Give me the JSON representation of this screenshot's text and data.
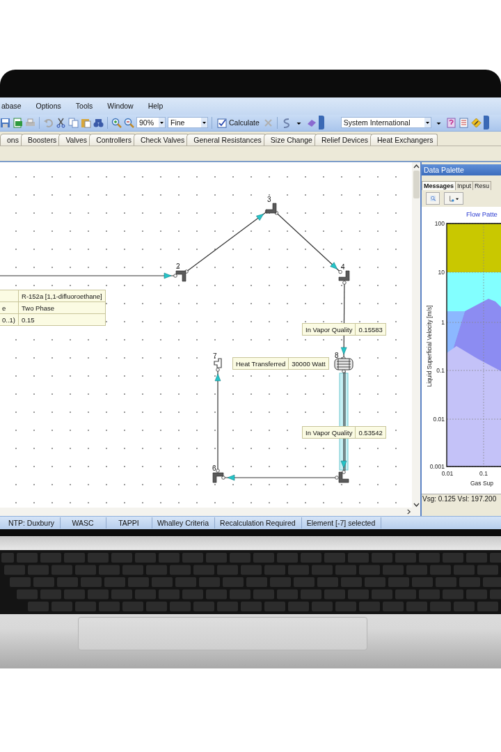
{
  "menu": [
    "abase",
    "Options",
    "Tools",
    "Window",
    "Help"
  ],
  "toolbar": {
    "zoom": "90%",
    "grid": "Fine",
    "calculate": "Calculate",
    "units": "System International"
  },
  "tabs": [
    {
      "label": "ons",
      "selected": false
    },
    {
      "label": "Boosters",
      "selected": false
    },
    {
      "label": "Valves",
      "selected": false
    },
    {
      "label": "Controllers",
      "selected": false
    },
    {
      "label": "Check Valves",
      "selected": false
    },
    {
      "label": "General Resistances",
      "selected": false
    },
    {
      "label": "Size Change",
      "selected": false
    },
    {
      "label": "Relief Devices",
      "selected": false
    },
    {
      "label": "Heat Exchangers",
      "selected": false
    }
  ],
  "diagram": {
    "nodes": [
      {
        "label": "2",
        "kind": "elbow"
      },
      {
        "label": "3",
        "kind": "elbow"
      },
      {
        "label": "4",
        "kind": "elbow"
      },
      {
        "label": "8",
        "kind": "heat_exchanger"
      },
      {
        "kind": "elbow"
      },
      {
        "label": "6",
        "kind": "elbow"
      },
      {
        "label": "7",
        "kind": "terminal"
      }
    ],
    "pipes": [
      {
        "selected": false
      },
      {
        "selected": false
      },
      {
        "selected": false
      },
      {
        "selected": false
      },
      {
        "selected": true
      },
      {
        "selected": false
      },
      {
        "selected": false
      }
    ],
    "property_boxes": [
      {
        "rows": [
          {
            "value": "R-152a [1,1-difluoroethane]"
          },
          {
            "name": "e",
            "value": "Two Phase"
          },
          {
            "name": "0..1)",
            "value": "0.15"
          }
        ]
      },
      {
        "rows": [
          {
            "name": "In Vapor Quality",
            "value": "0.15583"
          }
        ]
      },
      {
        "rows": [
          {
            "name": "Heat Transferred",
            "value": "30000 Watt"
          }
        ]
      },
      {
        "rows": [
          {
            "name": "In Vapor Quality",
            "value": "0.53542"
          }
        ]
      }
    ]
  },
  "data_palette": {
    "title": "Data Palette",
    "tabs": [
      {
        "label": "Messages",
        "selected": true
      },
      {
        "label": "Input",
        "selected": false
      },
      {
        "label": "Resu",
        "selected": false
      }
    ],
    "chart": {
      "title": "Flow Patte",
      "ylabel": "Liquid Superficial Velocity [m/s]",
      "xlabel": "Gas Sup",
      "yticks": [
        "100",
        "10",
        "1",
        "0.1",
        "0.01",
        "0.001"
      ],
      "xticks": [
        "0.01",
        "0.1"
      ]
    },
    "readout": "Vsg: 0.125   Vsl: 197.200"
  },
  "status_bar": [
    "NTP: Duxbury",
    "WASC",
    "TAPPI",
    "Whalley Criteria",
    "Recalculation Required",
    "Element [-7] selected"
  ]
}
